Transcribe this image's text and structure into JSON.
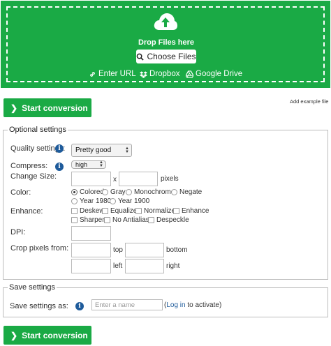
{
  "upload": {
    "drop_text": "Drop Files here",
    "choose_files": "Choose Files",
    "enter_url": "Enter URL",
    "dropbox": "Dropbox",
    "google_drive": "Google Drive"
  },
  "start_conversion": "Start conversion",
  "add_example_file": "Add example file",
  "optional": {
    "legend": "Optional settings",
    "quality_label": "Quality settings:",
    "quality_value": "Pretty good",
    "compress_label": "Compress:",
    "compress_value": "high",
    "change_size_label": "Change Size:",
    "size_x": "x",
    "size_unit": "pixels",
    "color_label": "Color:",
    "color_options": [
      "Colored",
      "Gray",
      "Monochrome",
      "Negate",
      "Year 1980",
      "Year 1900"
    ],
    "color_selected": "Colored",
    "enhance_label": "Enhance:",
    "enhance_options": [
      "Deskew",
      "Equalize",
      "Normalize",
      "Enhance",
      "Sharpen",
      "No Antialias",
      "Despeckle"
    ],
    "dpi_label": "DPI:",
    "crop_label": "Crop pixels from:",
    "crop_top": "top",
    "crop_bottom": "bottom",
    "crop_left": "left",
    "crop_right": "right"
  },
  "save": {
    "legend": "Save settings",
    "label": "Save settings as:",
    "placeholder": "Enter a name",
    "paren_open": "(",
    "login_link": "Log in",
    "suffix": " to activate)"
  },
  "colors": {
    "green": "#1aaa45",
    "info_blue": "#1e5b9b"
  }
}
